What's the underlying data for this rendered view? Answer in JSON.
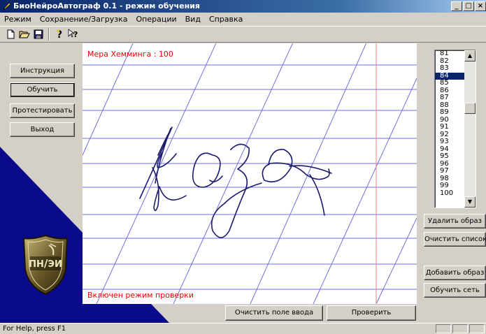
{
  "window": {
    "title": "БиоНейроАвтограф 0.1 - режим обучения",
    "controls": [
      "_",
      "□",
      "×"
    ]
  },
  "menu": [
    "Режим",
    "Сохранение/Загрузка",
    "Операции",
    "Вид",
    "Справка"
  ],
  "toolbar": {
    "icons": [
      "new-file-icon",
      "open-folder-icon",
      "save-icon",
      "help-icon",
      "context-help-icon"
    ]
  },
  "left_buttons": {
    "instruction": "Инструкция",
    "train": "Обучить",
    "test": "Протестировать",
    "exit": "Выход"
  },
  "logo": {
    "text": "ПН/ЭИ"
  },
  "canvas": {
    "hamming": "Мера Хемминга : 100",
    "mode_status": "Включен режим проверки",
    "handwriting": "коза"
  },
  "bottom_buttons": {
    "clear": "Очистить поле ввода",
    "check": "Проверить"
  },
  "samples": {
    "items": [
      "81",
      "82",
      "83",
      "84",
      "85",
      "86",
      "87",
      "88",
      "89",
      "90",
      "91",
      "92",
      "93",
      "94",
      "95",
      "96",
      "97",
      "98",
      "99",
      "100"
    ],
    "selected": "84"
  },
  "right_buttons": {
    "delete": "Удалить образ",
    "clear_list": "Очистить список",
    "add": "Добавить образ",
    "train_net": "Обучить сеть"
  },
  "statusbar": {
    "text": "For Help, press F1"
  },
  "colors": {
    "title_start": "#0a246a",
    "accent_red": "#e00000",
    "ink": "#1a1a6e",
    "ruling": "#7070e0",
    "navy": "#0a0a8c"
  }
}
